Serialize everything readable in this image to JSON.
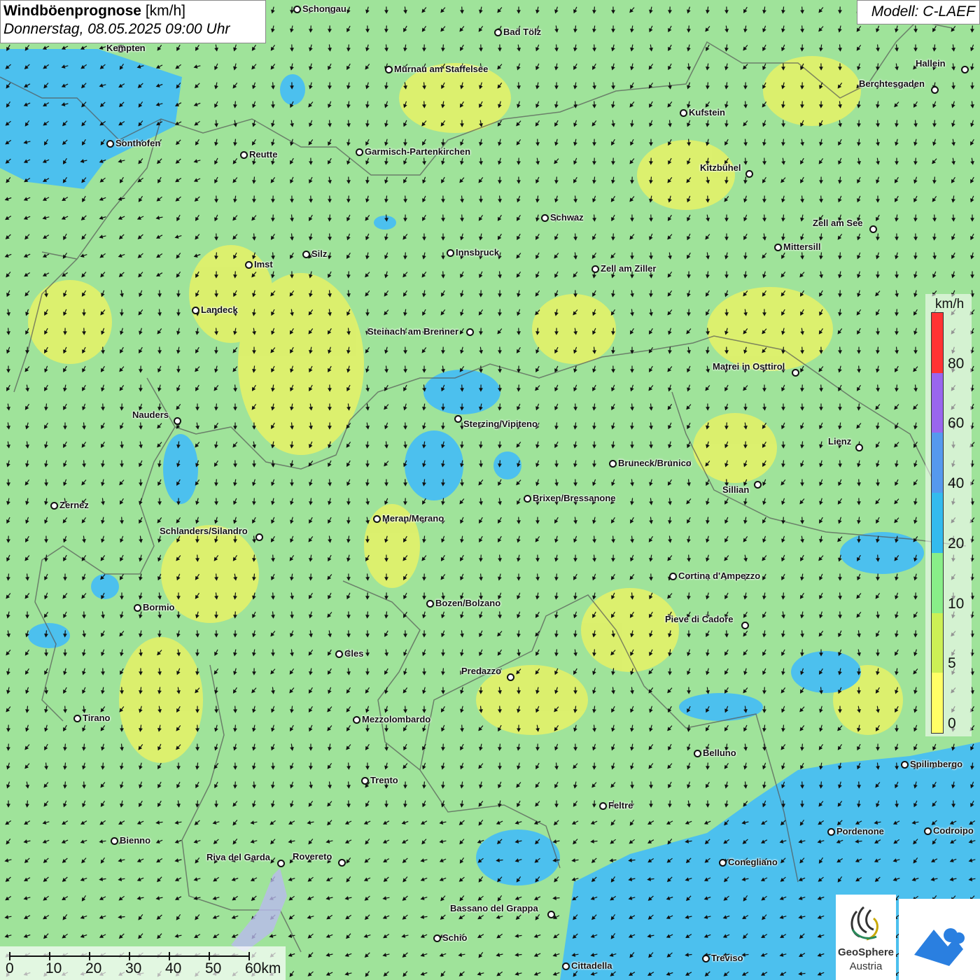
{
  "title": {
    "main": "Windböenprognose",
    "unit": "[km/h]",
    "datetime": "Donnerstag, 08.05.2025 09:00 Uhr"
  },
  "model": "Modell: C-LAEF",
  "legend": {
    "unit": "km/h",
    "ticks": [
      "80",
      "60",
      "40",
      "20",
      "10",
      "5",
      "0"
    ],
    "colors": [
      "#ff3333",
      "#9966ee",
      "#5599ee",
      "#33bbee",
      "#88ee88",
      "#ccf055",
      "#ffff66"
    ]
  },
  "scale": {
    "labels": [
      "0",
      "10",
      "20",
      "30",
      "40",
      "50",
      "60km"
    ]
  },
  "logo": {
    "name1": "GeoSphere",
    "name2": "Austria"
  },
  "cities": [
    {
      "name": "Schongau"
    },
    {
      "name": "Bad Tölz"
    },
    {
      "name": "Kempten"
    },
    {
      "name": "Murnau am Staffelsee"
    },
    {
      "name": "Hallein"
    },
    {
      "name": "Berchtesgaden"
    },
    {
      "name": "Kufstein"
    },
    {
      "name": "Sonthofen"
    },
    {
      "name": "Reutte"
    },
    {
      "name": "Garmisch-Partenkirchen"
    },
    {
      "name": "Kitzbühel"
    },
    {
      "name": "Schwaz"
    },
    {
      "name": "Zell am See"
    },
    {
      "name": "Mittersill"
    },
    {
      "name": "Silz"
    },
    {
      "name": "Innsbruck"
    },
    {
      "name": "Imst"
    },
    {
      "name": "Zell am Ziller"
    },
    {
      "name": "Landeck"
    },
    {
      "name": "Steinach am Brenner"
    },
    {
      "name": "Matrei in Osttirol"
    },
    {
      "name": "Nauders"
    },
    {
      "name": "Sterzing/Vipiteno"
    },
    {
      "name": "Lienz"
    },
    {
      "name": "Bruneck/Brunico"
    },
    {
      "name": "Sillian"
    },
    {
      "name": "Zernez"
    },
    {
      "name": "Brixen/Bressanone"
    },
    {
      "name": "Meran/Merano"
    },
    {
      "name": "Schlanders/Silandro"
    },
    {
      "name": "Cortina d'Ampezzo"
    },
    {
      "name": "Bozen/Bolzano"
    },
    {
      "name": "Bormio"
    },
    {
      "name": "Pieve di Cadore"
    },
    {
      "name": "Cles"
    },
    {
      "name": "Predazzo"
    },
    {
      "name": "Tirano"
    },
    {
      "name": "Mezzolombardo"
    },
    {
      "name": "Belluno"
    },
    {
      "name": "Spilimbergo"
    },
    {
      "name": "Trento"
    },
    {
      "name": "Feltre"
    },
    {
      "name": "Pordenone"
    },
    {
      "name": "Codroipo"
    },
    {
      "name": "Bienno"
    },
    {
      "name": "Riva del Garda"
    },
    {
      "name": "Rovereto"
    },
    {
      "name": "Conegliano"
    },
    {
      "name": "Bassano del Grappa"
    },
    {
      "name": "Schio"
    },
    {
      "name": "Treviso"
    },
    {
      "name": "Cittadella"
    }
  ]
}
